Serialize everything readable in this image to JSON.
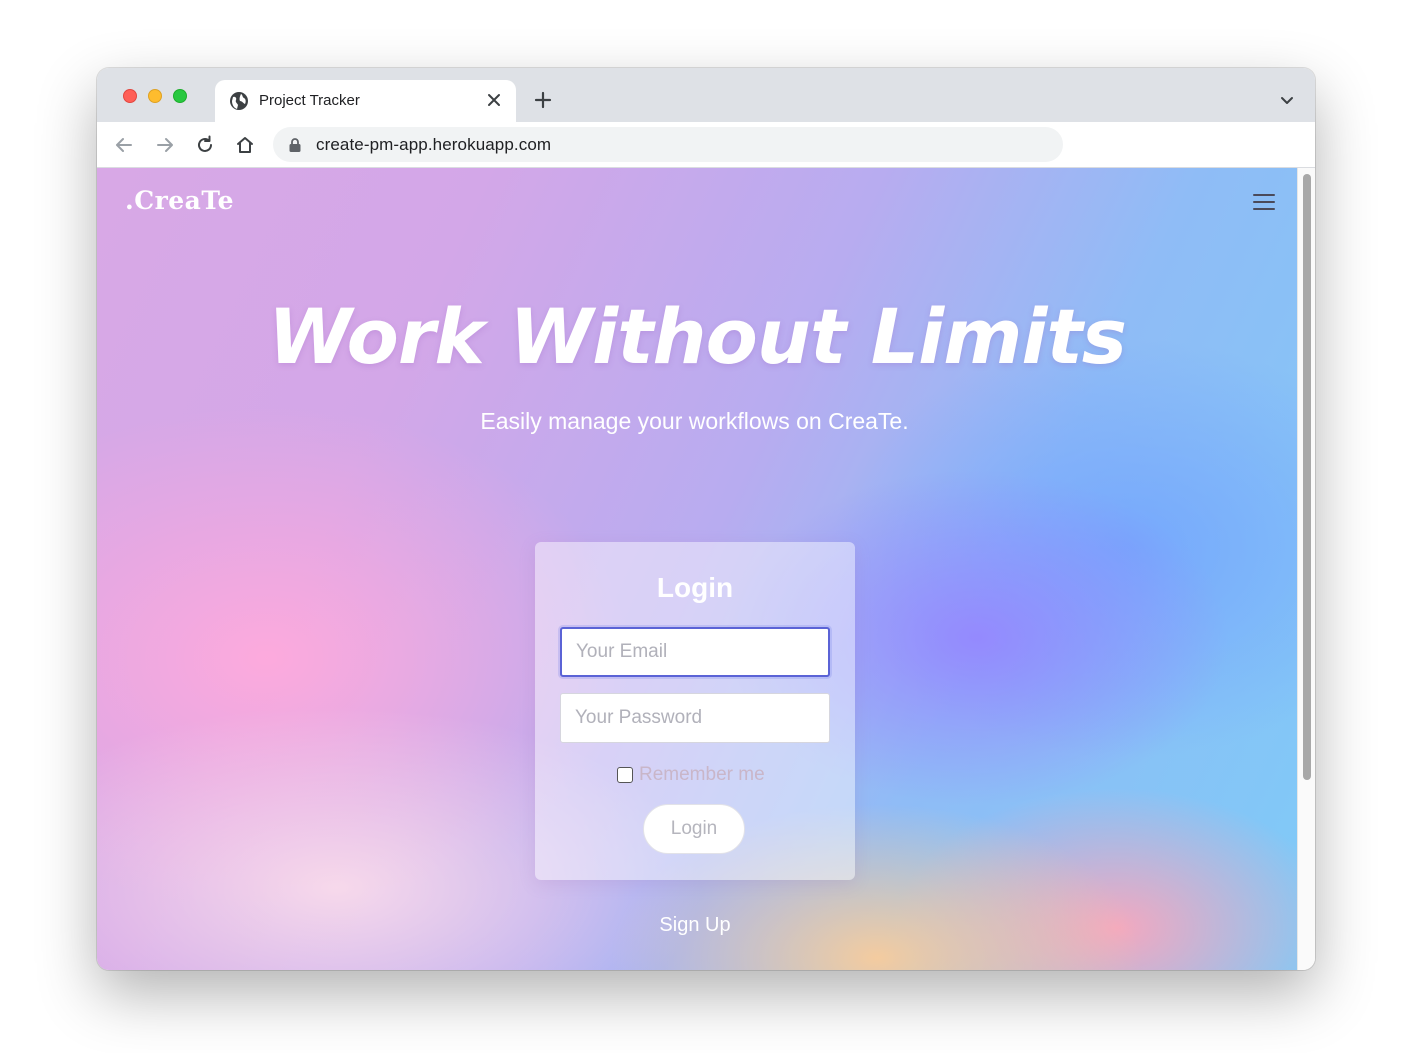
{
  "browser": {
    "tab_title": "Project Tracker",
    "url": "create-pm-app.herokuapp.com",
    "traffic_colors": {
      "close": "#ff5f57",
      "minimize": "#febc2e",
      "zoom": "#28c840"
    }
  },
  "page": {
    "brand": ".CreaTe",
    "hero_title": "Work Without Limits",
    "hero_subtitle": "Easily manage your workflows on CreaTe.",
    "login": {
      "title": "Login",
      "email_placeholder": "Your Email",
      "password_placeholder": "Your Password",
      "remember_label": "Remember me",
      "remember_checked": false,
      "button_label": "Login"
    },
    "signup_link": "Sign Up"
  },
  "icons": [
    "globe-icon",
    "close-icon",
    "plus-icon",
    "chevron-down-icon",
    "back-arrow-icon",
    "forward-arrow-icon",
    "reload-icon",
    "home-icon",
    "lock-icon",
    "hamburger-menu-icon"
  ],
  "colors": {
    "focus_border": "#5b63d6"
  }
}
